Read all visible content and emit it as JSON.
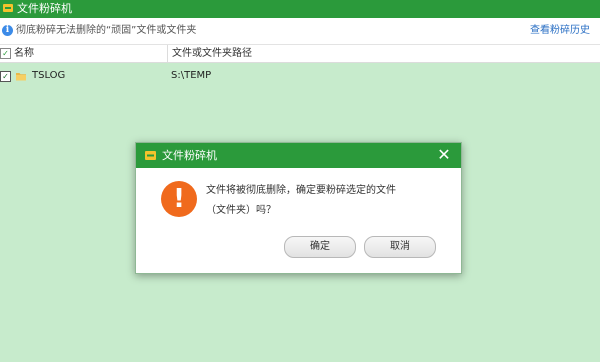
{
  "window": {
    "title": "文件粉碎机",
    "app_icon": "shredder-icon",
    "accent_color": "#2b9a3b",
    "background_color": "#c7ebcc"
  },
  "infobar": {
    "icon": "info-icon",
    "icon_glyph": "i",
    "text": "彻底粉碎无法删除的“顽固”文件或文件夹",
    "history_link": "查看粉碎历史"
  },
  "table": {
    "header_check": "✓",
    "columns": [
      "名称",
      "文件或文件夹路径"
    ],
    "rows": [
      {
        "checked": "✓",
        "icon": "folder-icon",
        "name": "TSLOG",
        "path": "S:\\TEMP"
      }
    ]
  },
  "dialog": {
    "title": "文件粉碎机",
    "close_glyph": "✕",
    "warning_glyph": "!",
    "warning_color": "#f06a1d",
    "message_line1": "文件将被彻底删除，确定要粉碎选定的文件",
    "message_line2": "（文件夹）吗？",
    "ok_label": "确定",
    "cancel_label": "取消"
  }
}
